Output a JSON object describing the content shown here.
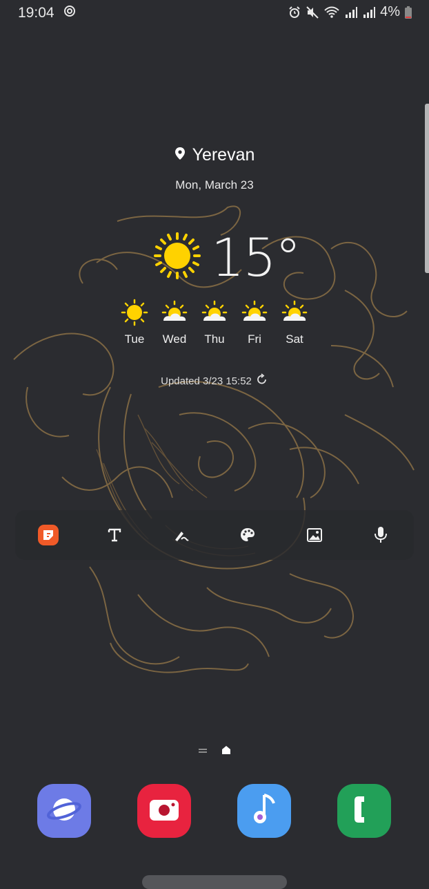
{
  "status_bar": {
    "time": "19:04",
    "battery": "4%",
    "icons": [
      "sync-icon",
      "alarm-icon",
      "mute-icon",
      "wifi-icon",
      "signal-icon",
      "signal-icon",
      "battery-icon"
    ]
  },
  "weather": {
    "location": "Yerevan",
    "date": "Mon, March 23",
    "temperature": "15°",
    "current_icon": "sun-icon",
    "forecast": [
      {
        "day": "Tue",
        "icon": "sun-icon"
      },
      {
        "day": "Wed",
        "icon": "partly-cloudy-icon"
      },
      {
        "day": "Thu",
        "icon": "partly-cloudy-icon"
      },
      {
        "day": "Fri",
        "icon": "partly-cloudy-icon"
      },
      {
        "day": "Sat",
        "icon": "partly-cloudy-icon"
      }
    ],
    "updated": "Updated 3/23 15:52"
  },
  "toolbar": {
    "items": [
      "sticky-note-icon",
      "text-icon",
      "pen-icon",
      "palette-icon",
      "image-icon",
      "microphone-icon"
    ]
  },
  "dock": {
    "apps": [
      "internet-browser",
      "camera",
      "music",
      "phone"
    ],
    "colors": {
      "browser": "#6d7be6",
      "camera": "#e8233f",
      "music": "#4b9df0",
      "phone": "#22a058"
    }
  },
  "colors": {
    "background": "#2b2c30",
    "sun": "#ffd200",
    "dragon": "#8f7348"
  }
}
